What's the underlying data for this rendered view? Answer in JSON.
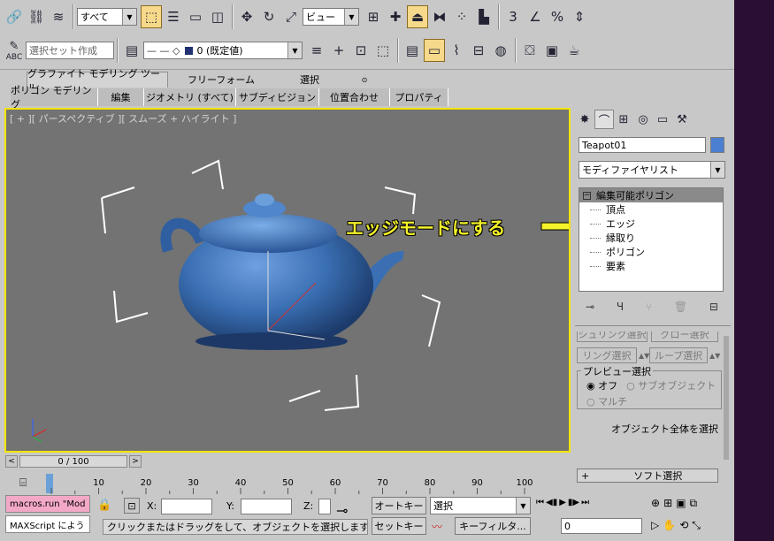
{
  "toolbar1": {
    "selection_filter": "すべて",
    "reference_coord": "ビュー"
  },
  "toolbar2": {
    "named_selection": "選択セット作成",
    "abc": "ABC",
    "layer": "0 (既定値)"
  },
  "ribbon": {
    "tabs": [
      "グラファイト モデリング ツール",
      "フリーフォーム",
      "選択"
    ],
    "subtabs": [
      "ポリゴン モデリング",
      "編集",
      "ジオメトリ (すべて)",
      "サブディビジョン",
      "位置合わせ",
      "プロパティ"
    ]
  },
  "viewport": {
    "label": "[ + ][ パースペクティブ ][ スムーズ + ハイライト ]",
    "callout": "エッジモードにする"
  },
  "command_panel": {
    "object_name": "Teapot01",
    "modifier_list": "モディファイヤリスト",
    "stack_root": "編集可能ポリゴン",
    "stack_items": [
      "頂点",
      "エッジ",
      "縁取り",
      "ポリゴン",
      "要素"
    ],
    "rollout": {
      "shrink": "シュリンク選択",
      "grow": "グロー選択",
      "ring": "リング選択",
      "loop": "ループ選択",
      "preview_title": "プレビュー選択",
      "off": "オフ",
      "subobject": "サブオブジェクト",
      "multi": "マルチ",
      "select_whole": "オブジェクト全体を選択",
      "soft_select": "ソフト選択",
      "soft_select_sign": "+"
    }
  },
  "timeline": {
    "frame": "0 / 100",
    "ticks": [
      "0",
      "10",
      "20",
      "30",
      "40",
      "50",
      "60",
      "70",
      "80",
      "90",
      "100"
    ]
  },
  "status": {
    "script_line1": "macros.run \"Mod",
    "script_line2": "MAXScript によう",
    "x_label": "X:",
    "y_label": "Y:",
    "z_label": "Z:",
    "message": "クリックまたはドラッグをして、オブジェクトを選択します",
    "autokey": "オートキー",
    "setkey": "セットキー",
    "key_mode": "選択",
    "key_filter": "キーフィルタ...",
    "current_frame": "0"
  },
  "colors": {
    "viewport_bg": "#737373",
    "active_border": "#f2e400",
    "callout": "#f4f22a",
    "teapot": "#3a6fb3",
    "desktop": "#2a0f33"
  }
}
